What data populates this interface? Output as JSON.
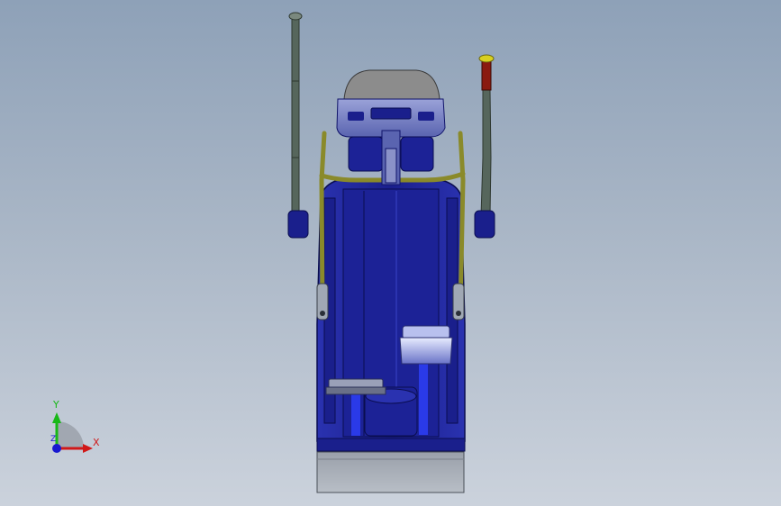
{
  "viewport": {
    "background_top": "#8ea1b8",
    "background_bottom": "#cbd2dc"
  },
  "model": {
    "body_color": "#1a1f8c",
    "body_shade": "#10146a",
    "body_highlight": "#3a44c8",
    "handle_color": "#8a8a2a",
    "pole_color": "#56665c",
    "grip_red": "#8a1a10",
    "grip_tip": "#d8d020",
    "base_color": "#a7adb6",
    "console_color": "#7a84c0",
    "screen_color": "#8c8c8c"
  },
  "triad": {
    "x_label": "X",
    "y_label": "Y",
    "z_label": "Z",
    "x_color": "#d01818",
    "y_color": "#18b818",
    "z_color": "#1818d0"
  }
}
